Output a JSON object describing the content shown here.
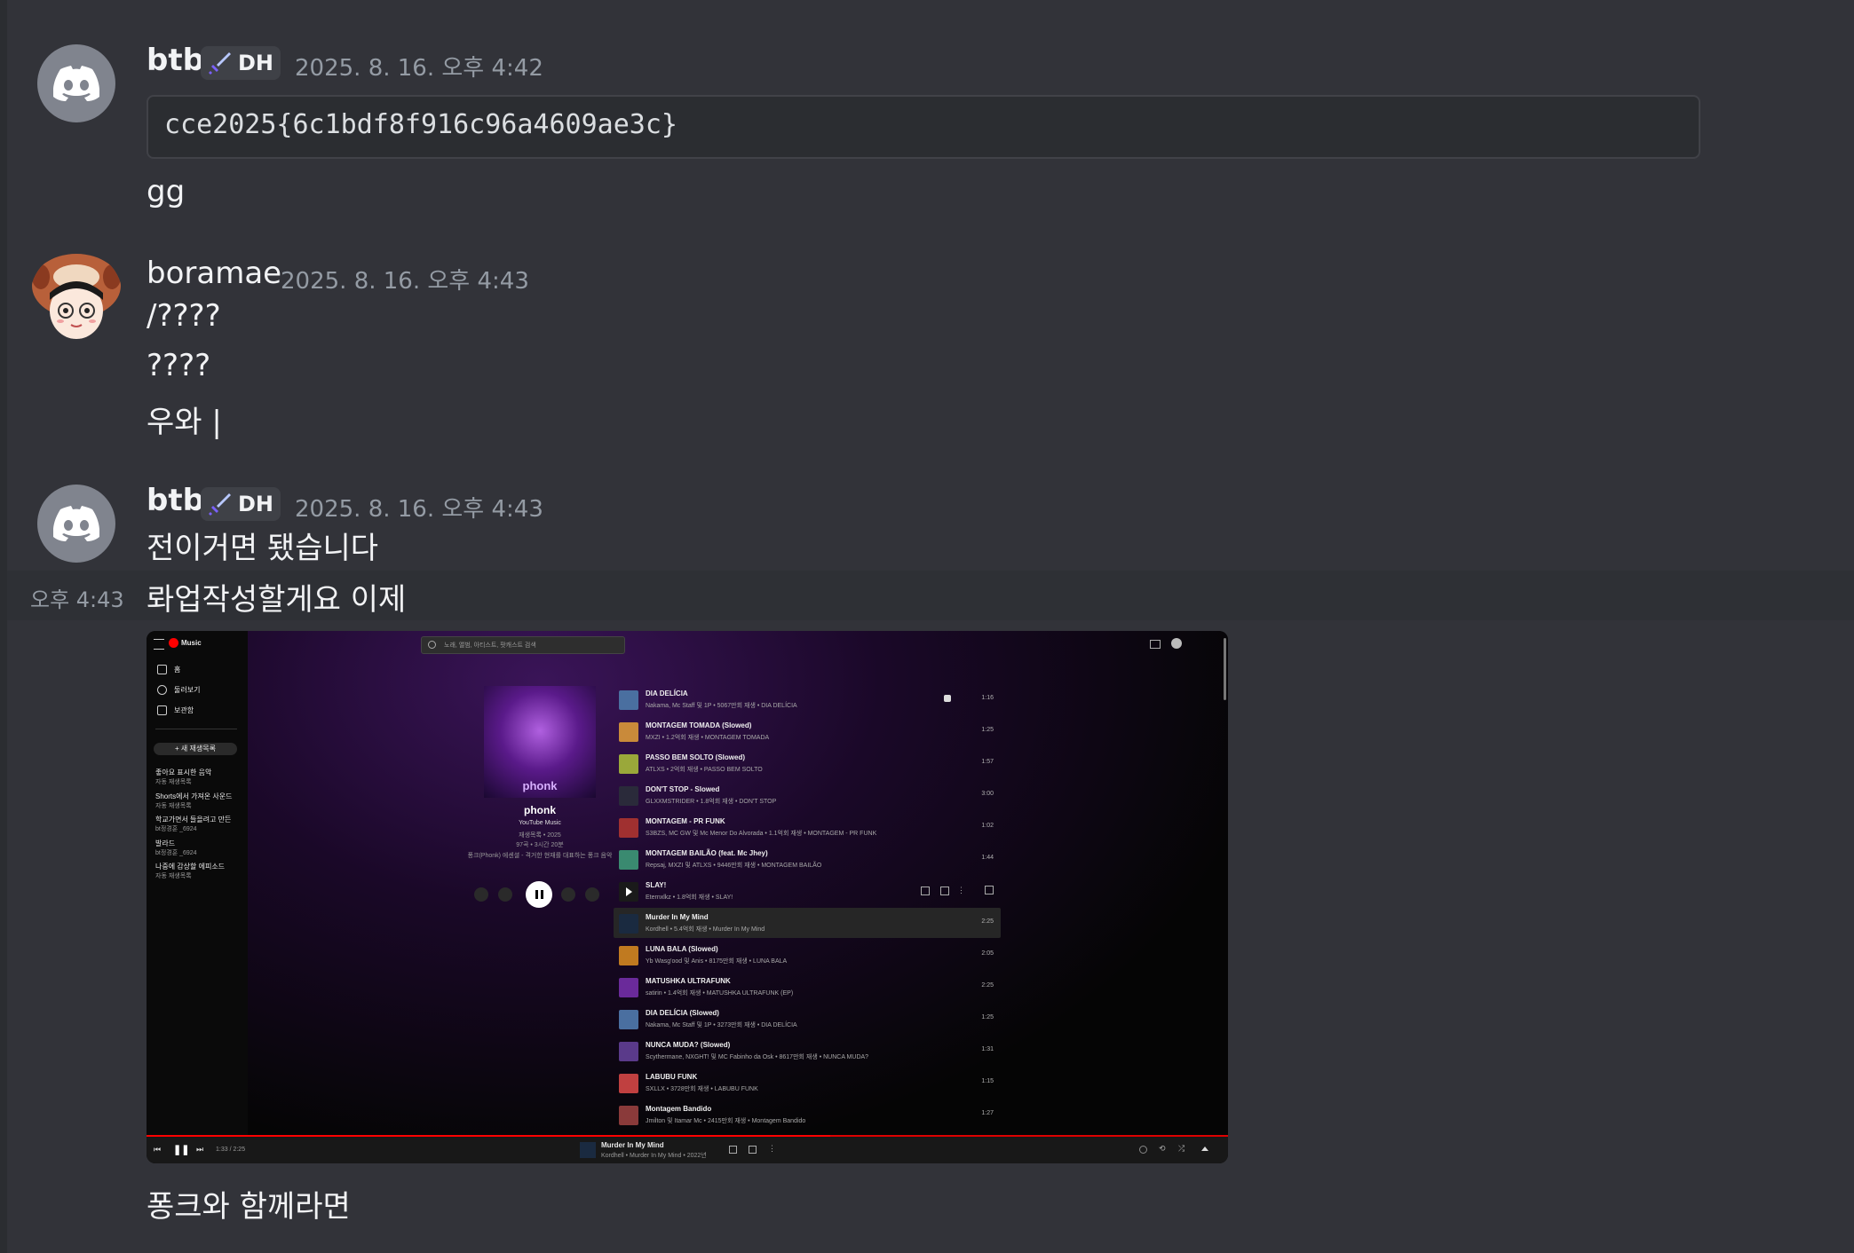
{
  "messages": {
    "m1": {
      "username": "btb",
      "badge": "DH",
      "timestamp": "2025. 8. 16. 오후 4:42",
      "code": "cce2025{6c1bdf8f916c96a4609ae3c}",
      "text": "gg"
    },
    "m2": {
      "username": "boramae",
      "timestamp": "2025. 8. 16. 오후 4:43",
      "lines": [
        "/????",
        "????",
        "우와 |"
      ]
    },
    "m3": {
      "username": "btb",
      "badge": "DH",
      "timestamp": "2025. 8. 16. 오후 4:43",
      "line1": "전이거면 됐습니다",
      "hover_time": "오후 4:43",
      "line2": "롸업작성할게요 이제",
      "line3": "퐁크와 함께라면"
    }
  },
  "ytmusic": {
    "logo": "Music",
    "search_placeholder": "노래, 앨범, 아티스트, 팟캐스트 검색",
    "nav": [
      "홈",
      "둘러보기",
      "보관함"
    ],
    "new_playlist": "+ 새 재생목록",
    "playlists": [
      {
        "name": "좋아요 표시한 음악",
        "sub": "자동 재생목록"
      },
      {
        "name": "Shorts에서 가져온 사운드",
        "sub": "자동 재생목록"
      },
      {
        "name": "학교가면서 들을려고 만든",
        "sub": "bt정경훈 _6924"
      },
      {
        "name": "발라드",
        "sub": "bt정경훈 _6924"
      },
      {
        "name": "나중에 감상할 에피소드",
        "sub": "자동 재생목록"
      }
    ],
    "album": {
      "art_label": "phonk",
      "title": "phonk",
      "owner": "YouTube Music",
      "meta1": "재생목록 • 2025",
      "meta2": "97곡 • 3시간 20분",
      "desc": "퐁크(Phonk) 에센셜 - 격거한 현재를 대표하는 퐁크 음악"
    },
    "tracks": [
      {
        "title": "DIA DELÍCIA",
        "sub": "Nakama, Mc Staff 및 1P • 5067만회 재생 • DIA DELÍCIA",
        "dur": "1:16",
        "color": "#4a6fa0"
      },
      {
        "title": "MONTAGEM TOMADA (Slowed)",
        "sub": "MXZI • 1.2억회 재생 • MONTAGEM TOMADA",
        "dur": "1:25",
        "color": "#c98a3a"
      },
      {
        "title": "PASSO BEM SOLTO (Slowed)",
        "sub": "ATLXS • 2억회 재생 • PASSO BEM SOLTO",
        "dur": "1:57",
        "color": "#9aa83a"
      },
      {
        "title": "DON'T STOP - Slowed",
        "sub": "GLXXMSTRIDER • 1.8억회 재생 • DON'T STOP",
        "dur": "3:00",
        "color": "#2a2a3a"
      },
      {
        "title": "MONTAGEM - PR FUNK",
        "sub": "S3BZS, MC GW 및 Mc Menor Do Alvorada • 1.1억회 재생 • MONTAGEM - PR FUNK",
        "dur": "1:02",
        "color": "#a03030"
      },
      {
        "title": "MONTAGEM BAILÃO (feat. Mc Jhey)",
        "sub": "Repsaj, MXZI 및 ATLXS • 9446만회 재생 • MONTAGEM BAILÃO",
        "dur": "1:44",
        "color": "#3a8a70"
      },
      {
        "title": "SLAY!",
        "sub": "Eternxlkz • 1.8억회 재생 • SLAY!",
        "dur": "",
        "color": "#1a1a1a"
      },
      {
        "title": "Murder In My Mind",
        "sub": "Kordhell • 5.4억회 재생 • Murder In My Mind",
        "dur": "2:25",
        "color": "#1a2a40"
      },
      {
        "title": "LUNA BALA (Slowed)",
        "sub": "Yb Wasg'ood 및 Anis • 8175만회 재생 • LUNA BALA",
        "dur": "2:05",
        "color": "#c07a20"
      },
      {
        "title": "MATUSHKA ULTRAFUNK",
        "sub": "satirin • 1.4억회 재생 • MATUSHKA ULTRAFUNK (EP)",
        "dur": "2:25",
        "color": "#6a2a9a"
      },
      {
        "title": "DIA DELÍCIA (Slowed)",
        "sub": "Nakama, Mc Staff 및 1P • 3273만회 재생 • DIA DELÍCIA",
        "dur": "1:25",
        "color": "#4a6fa0"
      },
      {
        "title": "NUNCA MUDA? (Slowed)",
        "sub": "Scythermane, NXGHT! 및 MC Fabinho da Osk • 8617만회 재생 • NUNCA MUDA?",
        "dur": "1:31",
        "color": "#5a3a8a"
      },
      {
        "title": "LABUBU FUNK",
        "sub": "SXLLX • 3728만회 재생 • LABUBU FUNK",
        "dur": "1:15",
        "color": "#c04040"
      },
      {
        "title": "Montagem Bandido",
        "sub": "Jmilton 및 Itamar Mc • 2415만회 재생 • Montagem Bandido",
        "dur": "1:27",
        "color": "#8a3a3a"
      }
    ],
    "player": {
      "time": "1:33 / 2:25",
      "title": "Murder In My Mind",
      "sub": "Kordhell • Murder In My Mind • 2022년"
    }
  }
}
